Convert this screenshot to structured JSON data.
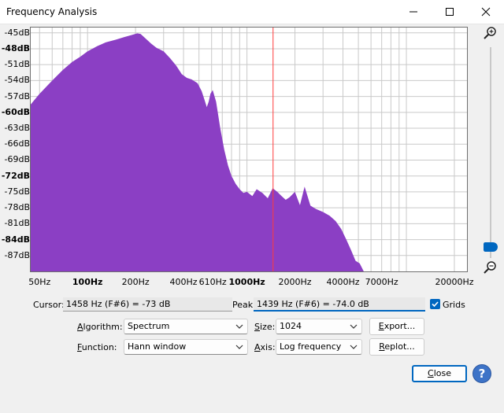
{
  "window": {
    "title": "Frequency Analysis"
  },
  "plot": {
    "y_labels": [
      "-45dB",
      "-48dB",
      "-51dB",
      "-54dB",
      "-57dB",
      "-60dB",
      "-63dB",
      "-66dB",
      "-69dB",
      "-72dB",
      "-75dB",
      "-78dB",
      "-81dB",
      "-84dB",
      "-87dB"
    ],
    "x_labels": [
      "50Hz",
      "100Hz",
      "200Hz",
      "400Hz",
      "610Hz",
      "1000Hz",
      "2000Hz",
      "4000Hz",
      "7000Hz",
      "20000Hz"
    ],
    "fill_color": "#8b3fc4",
    "cursor_line_color": "#ff3b3b"
  },
  "chart_data": {
    "type": "area",
    "x_scale": "log",
    "x": [
      44,
      50,
      60,
      70,
      80,
      90,
      100,
      115,
      130,
      150,
      170,
      190,
      205,
      215,
      230,
      250,
      270,
      300,
      330,
      360,
      390,
      420,
      450,
      490,
      520,
      540,
      560,
      575,
      590,
      610,
      640,
      680,
      720,
      760,
      800,
      850,
      900,
      950,
      1000,
      1080,
      1150,
      1250,
      1350,
      1450,
      1550,
      1650,
      1750,
      1850,
      2000,
      2150,
      2300,
      2500,
      2700,
      3000,
      3300,
      3600,
      3900,
      4200,
      4500,
      4800,
      5100,
      5400,
      5700,
      6000
    ],
    "y": [
      -58.5,
      -56.5,
      -54,
      -52,
      -50.5,
      -49.5,
      -48.5,
      -47.5,
      -46.8,
      -46.3,
      -45.8,
      -45.4,
      -45.1,
      -45.2,
      -46,
      -47,
      -47.8,
      -48.5,
      -49.8,
      -51.2,
      -52.8,
      -53.5,
      -53.8,
      -54.5,
      -56,
      -57.5,
      -59,
      -58,
      -56.5,
      -55.8,
      -58,
      -63,
      -67,
      -70,
      -72,
      -73.5,
      -74.5,
      -75.2,
      -75,
      -75.8,
      -74.5,
      -75.2,
      -76.2,
      -74.3,
      -75,
      -75.8,
      -76.5,
      -76,
      -75,
      -77.5,
      -74,
      -77.6,
      -78.2,
      -78.8,
      -79.5,
      -80.5,
      -82,
      -84,
      -86,
      -88,
      -88.5,
      -90,
      -91.5,
      -93
    ],
    "ylim": [
      -90,
      -44
    ],
    "xlim": [
      44,
      24000
    ],
    "y_tick_values": [
      -45,
      -48,
      -51,
      -54,
      -57,
      -60,
      -63,
      -66,
      -69,
      -72,
      -75,
      -78,
      -81,
      -84,
      -87
    ],
    "x_tick_values": [
      50,
      100,
      200,
      400,
      610,
      1000,
      2000,
      4000,
      7000,
      20000
    ],
    "cursor_x": 1458,
    "grid": true,
    "legend": "none"
  },
  "readouts": {
    "cursor_label": "Cursor:",
    "cursor_value": "1458 Hz (F#6) = -73 dB",
    "peak_label": "Peak:",
    "peak_value": "1439 Hz (F#6) = -74.0 dB",
    "grids_label": "Grids",
    "grids_checked": true
  },
  "controls": {
    "algorithm_label": "Algorithm:",
    "algorithm_value": "Spectrum",
    "size_label": "Size:",
    "size_value": "1024",
    "export_label": "Export...",
    "function_label": "Function:",
    "function_value": "Hann window",
    "axis_label": "Axis:",
    "axis_value": "Log frequency",
    "replot_label": "Replot...",
    "close_label": "Close",
    "help_label": "?"
  },
  "colors": {
    "accent": "#0067c0",
    "spectrum": "#8b3fc4",
    "cursor": "#ff3b3b"
  },
  "icons": {
    "minimize": "minimize-icon",
    "maximize": "maximize-icon",
    "close": "close-icon",
    "zoom_in": "zoom-in-icon",
    "zoom_out": "zoom-out-icon",
    "check": "check-icon",
    "chevron": "chevron-down-icon"
  }
}
